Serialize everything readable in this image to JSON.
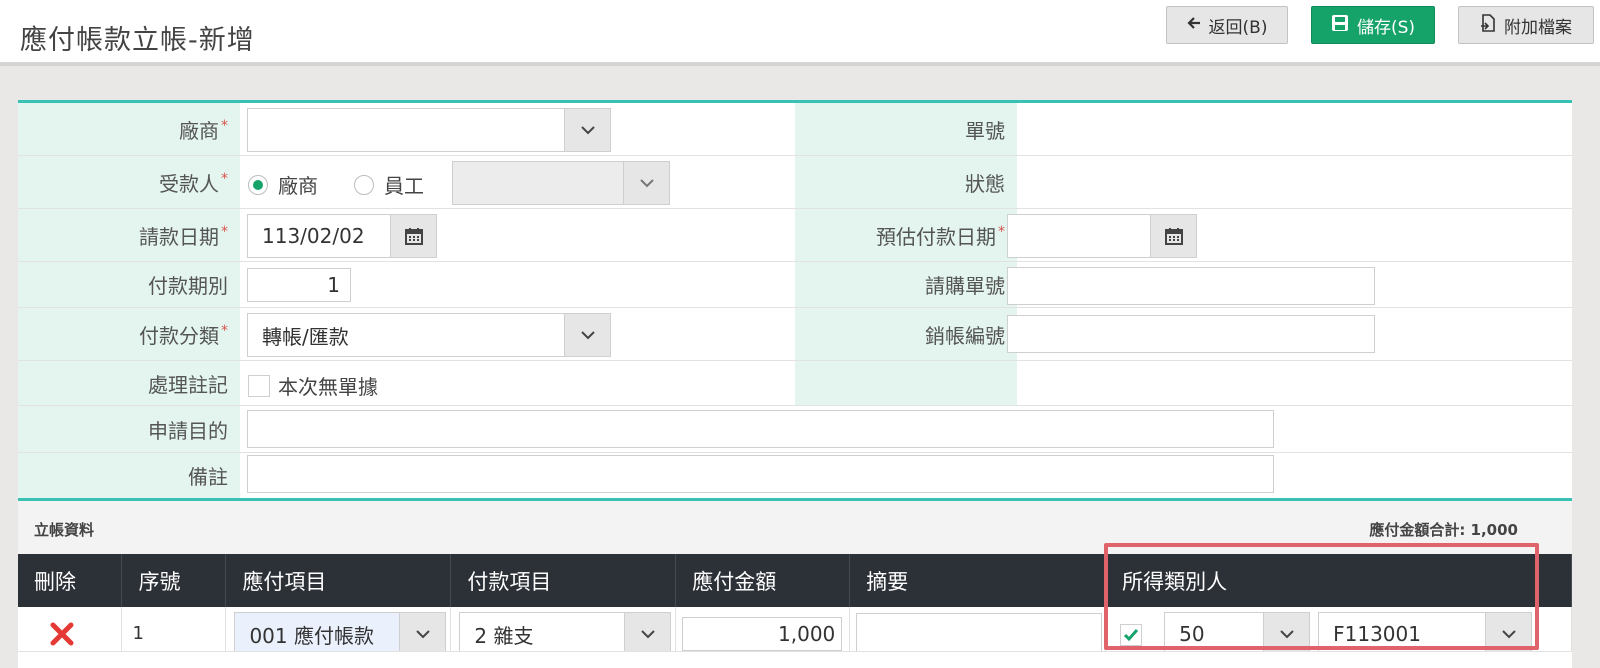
{
  "page": {
    "title": "應付帳款立帳-新增"
  },
  "toolbar": {
    "back_label": "返回(B)",
    "save_label": "儲存(S)",
    "attach_label": "附加檔案"
  },
  "form": {
    "vendor": {
      "label": "廠商",
      "value": ""
    },
    "doc_no": {
      "label": "單號",
      "value": ""
    },
    "payee": {
      "label": "受款人",
      "options": [
        "廠商",
        "員工"
      ],
      "selected": "廠商",
      "employee_select": ""
    },
    "status": {
      "label": "狀態",
      "value": ""
    },
    "request_date": {
      "label": "請款日期",
      "value": "113/02/02"
    },
    "est_pay_date": {
      "label": "預估付款日期",
      "value": ""
    },
    "pay_period": {
      "label": "付款期別",
      "value": "1"
    },
    "purchase_no": {
      "label": "請購單號",
      "value": ""
    },
    "pay_category": {
      "label": "付款分類",
      "value": "轉帳/匯款"
    },
    "writeoff_no": {
      "label": "銷帳編號",
      "value": ""
    },
    "processing_note": {
      "label": "處理註記",
      "checkbox_label": "本次無單據",
      "checked": false
    },
    "purpose": {
      "label": "申請目的",
      "value": ""
    },
    "remark": {
      "label": "備註",
      "value": ""
    }
  },
  "entries": {
    "section_title": "立帳資料",
    "total_label": "應付金額合計: 1,000",
    "columns": [
      "刪除",
      "序號",
      "應付項目",
      "付款項目",
      "應付金額",
      "摘要",
      "所得類別人"
    ],
    "rows": [
      {
        "seq": "1",
        "payable_item": "001 應付帳款",
        "pay_item": "2 雜支",
        "amount": "1,000",
        "summary": "",
        "income_checked": true,
        "income_type": "50",
        "income_person": "F113001"
      }
    ]
  },
  "colors": {
    "accent": "#39c1b4",
    "save": "#16a36a",
    "label_bg": "#e3f5ee",
    "header_dark": "#2c3037",
    "delete": "#e53935",
    "highlight": "#e0626a"
  }
}
